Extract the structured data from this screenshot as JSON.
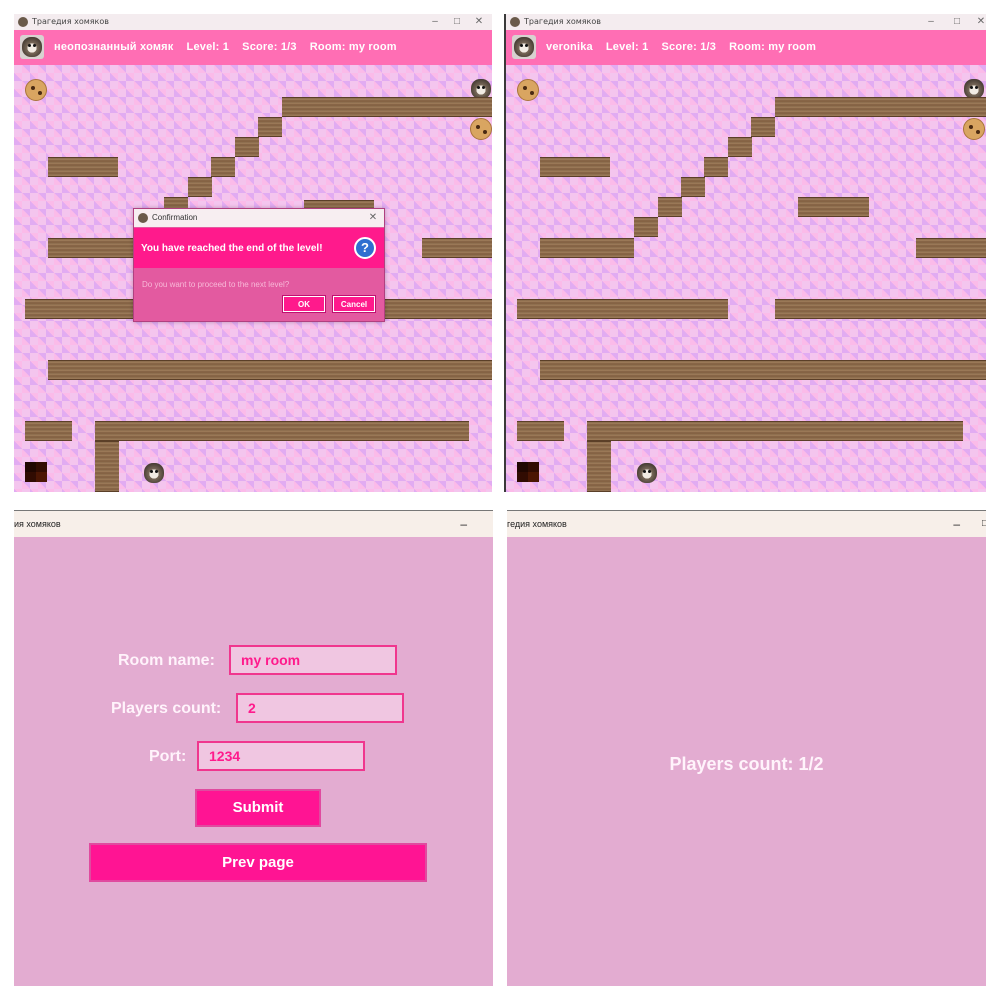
{
  "left_window": {
    "title": "Трагедия хомяков",
    "hud": {
      "player": "неопознанный хомяк",
      "level": "Level: 1",
      "score": "Score: 1/3",
      "room": "Room: my room"
    }
  },
  "right_window": {
    "title": "Трагедия хомяков",
    "hud": {
      "player": "veronika",
      "level": "Level: 1",
      "score": "Score: 1/3",
      "room": "Room: my room"
    }
  },
  "dialog": {
    "title": "Confirmation",
    "heading": "You have reached the end of the level!",
    "message": "Do you want to proceed to the next level?",
    "ok_label": "OK",
    "cancel_label": "Cancel",
    "icon": "question-icon"
  },
  "create_room_window": {
    "title": "ия хомяков",
    "room_name_label": "Room name:",
    "room_name_value": "my room",
    "players_count_label": "Players count:",
    "players_count_value": "2",
    "port_label": "Port:",
    "port_value": "1234",
    "submit_label": "Submit",
    "prev_label": "Prev page"
  },
  "waiting_window": {
    "title": "гедия хомяков",
    "players_count_text": "Players count: 1/2"
  },
  "window_buttons": {
    "minimize": "–",
    "maximize": "□",
    "close": "✕"
  },
  "colors": {
    "hud": "#ff6eb4",
    "accent": "#ff1493",
    "form_bg": "#e3acd1"
  }
}
